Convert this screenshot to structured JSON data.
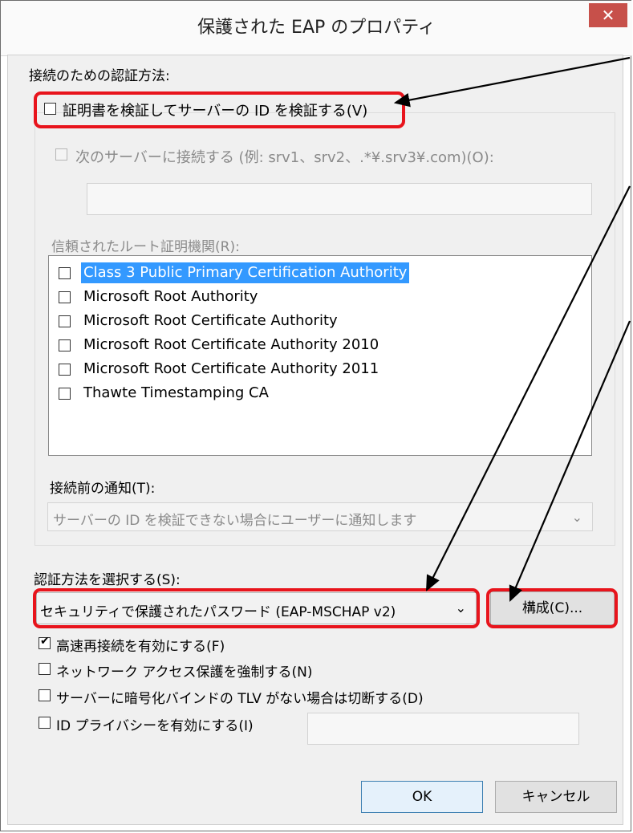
{
  "window": {
    "title": "保護された EAP のプロパティ",
    "close_glyph": "✕"
  },
  "auth_method_label": "接続のための認証方法:",
  "verify_cert": {
    "label": "証明書を検証してサーバーの ID を検証する(V)",
    "checked": false
  },
  "connect_servers": {
    "label": "次のサーバーに接続する (例: srv1、srv2、.*¥.srv3¥.com)(O):",
    "checked": false,
    "value": ""
  },
  "trusted_root_label": "信頼されたルート証明機関(R):",
  "trusted_roots": [
    {
      "label": "Class 3 Public Primary Certification Authority",
      "checked": false,
      "selected": true
    },
    {
      "label": "Microsoft Root Authority",
      "checked": false
    },
    {
      "label": "Microsoft Root Certificate Authority",
      "checked": false
    },
    {
      "label": "Microsoft Root Certificate Authority 2010",
      "checked": false
    },
    {
      "label": "Microsoft Root Certificate Authority 2011",
      "checked": false
    },
    {
      "label": "Thawte Timestamping CA",
      "checked": false
    }
  ],
  "pre_connect_notify": {
    "label": "接続前の通知(T):",
    "value": "サーバーの ID を検証できない場合にユーザーに通知します"
  },
  "select_auth": {
    "label": "認証方法を選択する(S):",
    "value": "セキュリティで保護されたパスワード (EAP-MSCHAP v2)"
  },
  "configure_button": "構成(C)...",
  "options": [
    {
      "label": "高速再接続を有効にする(F)",
      "checked": true
    },
    {
      "label": "ネットワーク アクセス保護を強制する(N)",
      "checked": false
    },
    {
      "label": "サーバーに暗号化バインドの TLV がない場合は切断する(D)",
      "checked": false
    },
    {
      "label": "ID プライバシーを有効にする(I)",
      "checked": false
    }
  ],
  "identity_privacy_value": "",
  "ok_button": "OK",
  "cancel_button": "キャンセル",
  "annotation_color": "#e8141c"
}
